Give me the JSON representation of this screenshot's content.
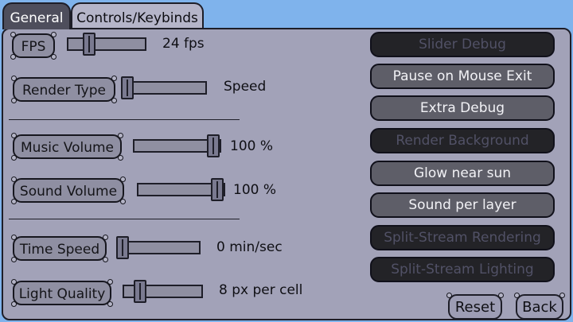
{
  "tabs": [
    {
      "label": "General",
      "active": true
    },
    {
      "label": "Controls/Keybinds",
      "active": false
    }
  ],
  "settings": [
    {
      "label": "FPS",
      "value": "24 fps",
      "slider_fraction": 0.25
    },
    {
      "label": "Render Type",
      "value": "Speed",
      "slider_fraction": 0.0
    },
    {
      "label": "Music Volume",
      "value": "100 %",
      "slider_fraction": 1.0
    },
    {
      "label": "Sound Volume",
      "value": "100 %",
      "slider_fraction": 1.0
    },
    {
      "label": "Time Speed",
      "value": "0 min/sec",
      "slider_fraction": 0.0
    },
    {
      "label": "Light Quality",
      "value": "8 px per cell",
      "slider_fraction": 0.08
    }
  ],
  "toggles": [
    {
      "label": "Slider Debug",
      "state": "dark"
    },
    {
      "label": "Pause on Mouse Exit",
      "state": "light"
    },
    {
      "label": "Extra Debug",
      "state": "light"
    },
    {
      "label": "Render Background",
      "state": "dark"
    },
    {
      "label": "Glow near sun",
      "state": "light"
    },
    {
      "label": "Sound per layer",
      "state": "light"
    },
    {
      "label": "Split-Stream Rendering",
      "state": "dark"
    },
    {
      "label": "Split-Stream Lighting",
      "state": "dark"
    }
  ],
  "actions": {
    "reset_label": "Reset",
    "back_label": "Back"
  },
  "colors": {
    "background": "#7fb3ec",
    "panel": "#a2a2b8",
    "active_tab": "#4e4e5c",
    "toggle_dark": "#232327",
    "toggle_light": "#5e5e68"
  }
}
